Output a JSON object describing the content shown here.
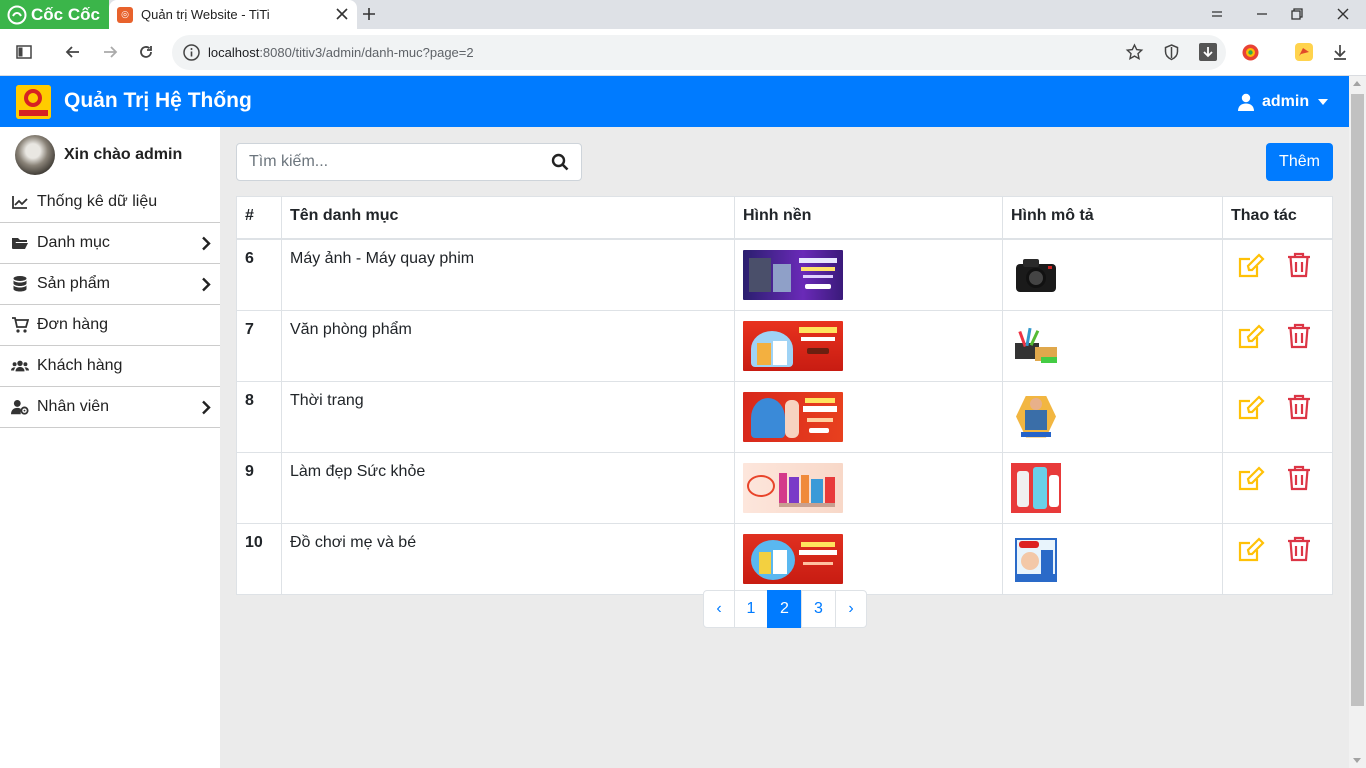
{
  "browser": {
    "brand": "Cốc Cốc",
    "tab_title": "Quản trị Website - TiTi",
    "url_host": "localhost",
    "url_rest": ":8080/titiv3/admin/danh-muc?page=2"
  },
  "header": {
    "title": "Quản Trị Hệ Thống",
    "user": "admin"
  },
  "sidebar": {
    "welcome": "Xin chào admin",
    "items": [
      {
        "label": "Thống kê dữ liệu",
        "icon": "line-chart-icon",
        "has_submenu": false
      },
      {
        "label": "Danh mục",
        "icon": "folder-open-icon",
        "has_submenu": true
      },
      {
        "label": "Sản phẩm",
        "icon": "database-icon",
        "has_submenu": true
      },
      {
        "label": "Đơn hàng",
        "icon": "shopping-cart-icon",
        "has_submenu": false
      },
      {
        "label": "Khách hàng",
        "icon": "users-icon",
        "has_submenu": false
      },
      {
        "label": "Nhân viên",
        "icon": "user-cog-icon",
        "has_submenu": true
      }
    ]
  },
  "search": {
    "placeholder": "Tìm kiếm..."
  },
  "add_button": "Thêm",
  "table": {
    "headers": [
      "#",
      "Tên danh mục",
      "Hình nền",
      "Hình mô tả",
      "Thao tác"
    ],
    "rows": [
      {
        "id": "6",
        "name": "Máy ảnh - Máy quay phim"
      },
      {
        "id": "7",
        "name": "Văn phòng phẩm"
      },
      {
        "id": "8",
        "name": "Thời trang"
      },
      {
        "id": "9",
        "name": "Làm đẹp Sức khỏe"
      },
      {
        "id": "10",
        "name": "Đồ chơi mẹ và bé"
      }
    ]
  },
  "pagination": {
    "prev": "‹",
    "next": "›",
    "pages": [
      "1",
      "2",
      "3"
    ],
    "current": "2"
  },
  "colors": {
    "primary": "#007bff",
    "edit": "#ffc107",
    "delete": "#dc3545"
  }
}
